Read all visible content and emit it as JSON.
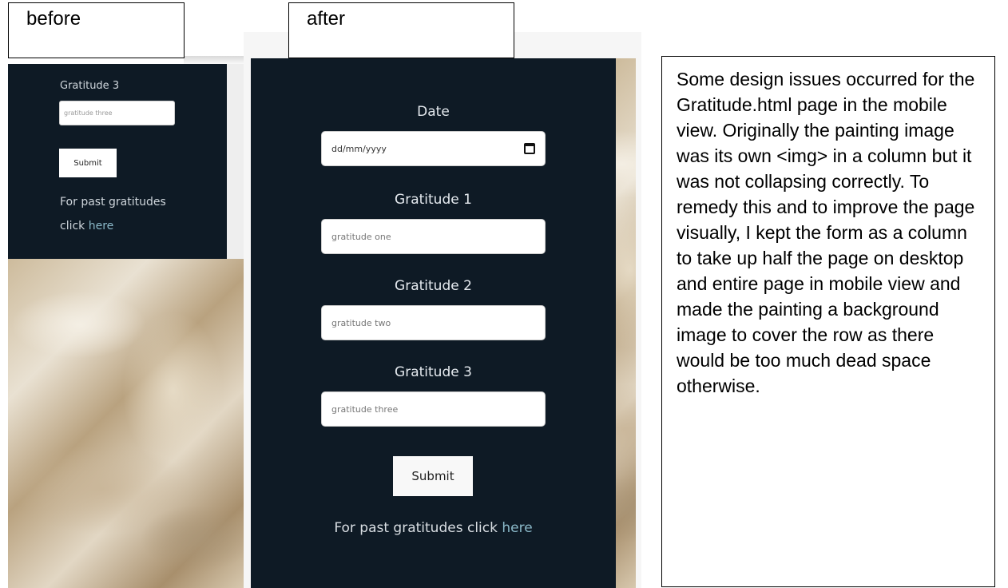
{
  "before": {
    "caption": "before",
    "gratitude3_label": "Gratitude 3",
    "gratitude3_placeholder": "gratitude three",
    "submit_label": "Submit",
    "past_line1": "For past gratitudes",
    "past_line2_prefix": "click ",
    "past_link": "here"
  },
  "after": {
    "caption": "after",
    "date_label": "Date",
    "date_placeholder": "dd/mm/yyyy",
    "gratitude1_label": "Gratitude 1",
    "gratitude1_placeholder": "gratitude one",
    "gratitude2_label": "Gratitude 2",
    "gratitude2_placeholder": "gratitude two",
    "gratitude3_label": "Gratitude 3",
    "gratitude3_placeholder": "gratitude three",
    "submit_label": "Submit",
    "past_prefix": "For past gratitudes click ",
    "past_link": "here"
  },
  "note": {
    "text": "Some design issues occurred for the Gratitude.html page in the mobile view. Originally the painting image was its own <img> in a column but it was not collapsing correctly. To remedy this and to improve the page visually, I kept the form as a column to take up half the page on desktop and entire page in mobile view and made the painting a background image to cover the row as there would be too much dead space otherwise."
  },
  "colors": {
    "panel_dark": "#0e1a25",
    "link": "#8ab8c8",
    "label_text": "#e4e9ee"
  },
  "icons": {
    "calendar": "calendar-icon"
  }
}
